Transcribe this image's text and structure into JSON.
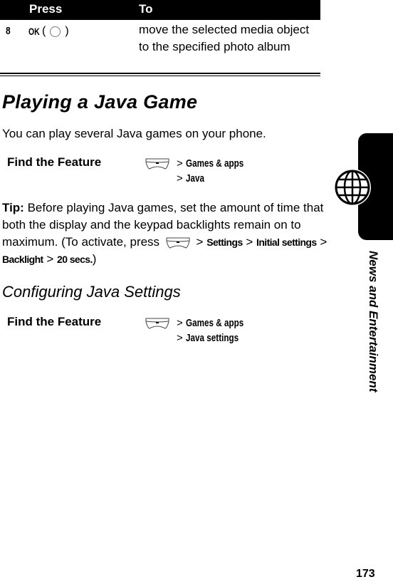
{
  "table": {
    "headers": [
      "Press",
      "To"
    ],
    "rows": [
      {
        "key": "8",
        "press_label": "OK",
        "press_icon": "center-select-key-icon",
        "to": "move the selected media object to the specified photo album"
      }
    ]
  },
  "section1": {
    "title": "Playing a Java Game",
    "intro": "You can play several Java games on your phone.",
    "find_the_feature": {
      "label": "Find the Feature",
      "key_icon": "menu-key-icon",
      "path": [
        "Games & apps",
        "Java"
      ]
    }
  },
  "tip": {
    "label": "Tip:",
    "text": "Before playing Java games, set the amount of time that both the display and the keypad backlights remain on to maximum. (To activate, press",
    "key_icon": "menu-key-icon",
    "path": [
      "Settings",
      "Initial settings",
      "Backlight",
      "20 secs."
    ],
    "closing": ")"
  },
  "section2": {
    "title": "Configuring Java Settings",
    "find_the_feature": {
      "label": "Find the Feature",
      "key_icon": "menu-key-icon",
      "path": [
        "Games & apps",
        "Java settings"
      ]
    }
  },
  "side_tab": {
    "icon": "globe-icon",
    "label": "News and Entertainment"
  },
  "page_number": "173",
  "symbols": {
    "gt": ">",
    "open_paren": "(",
    "close_paren": ")"
  }
}
